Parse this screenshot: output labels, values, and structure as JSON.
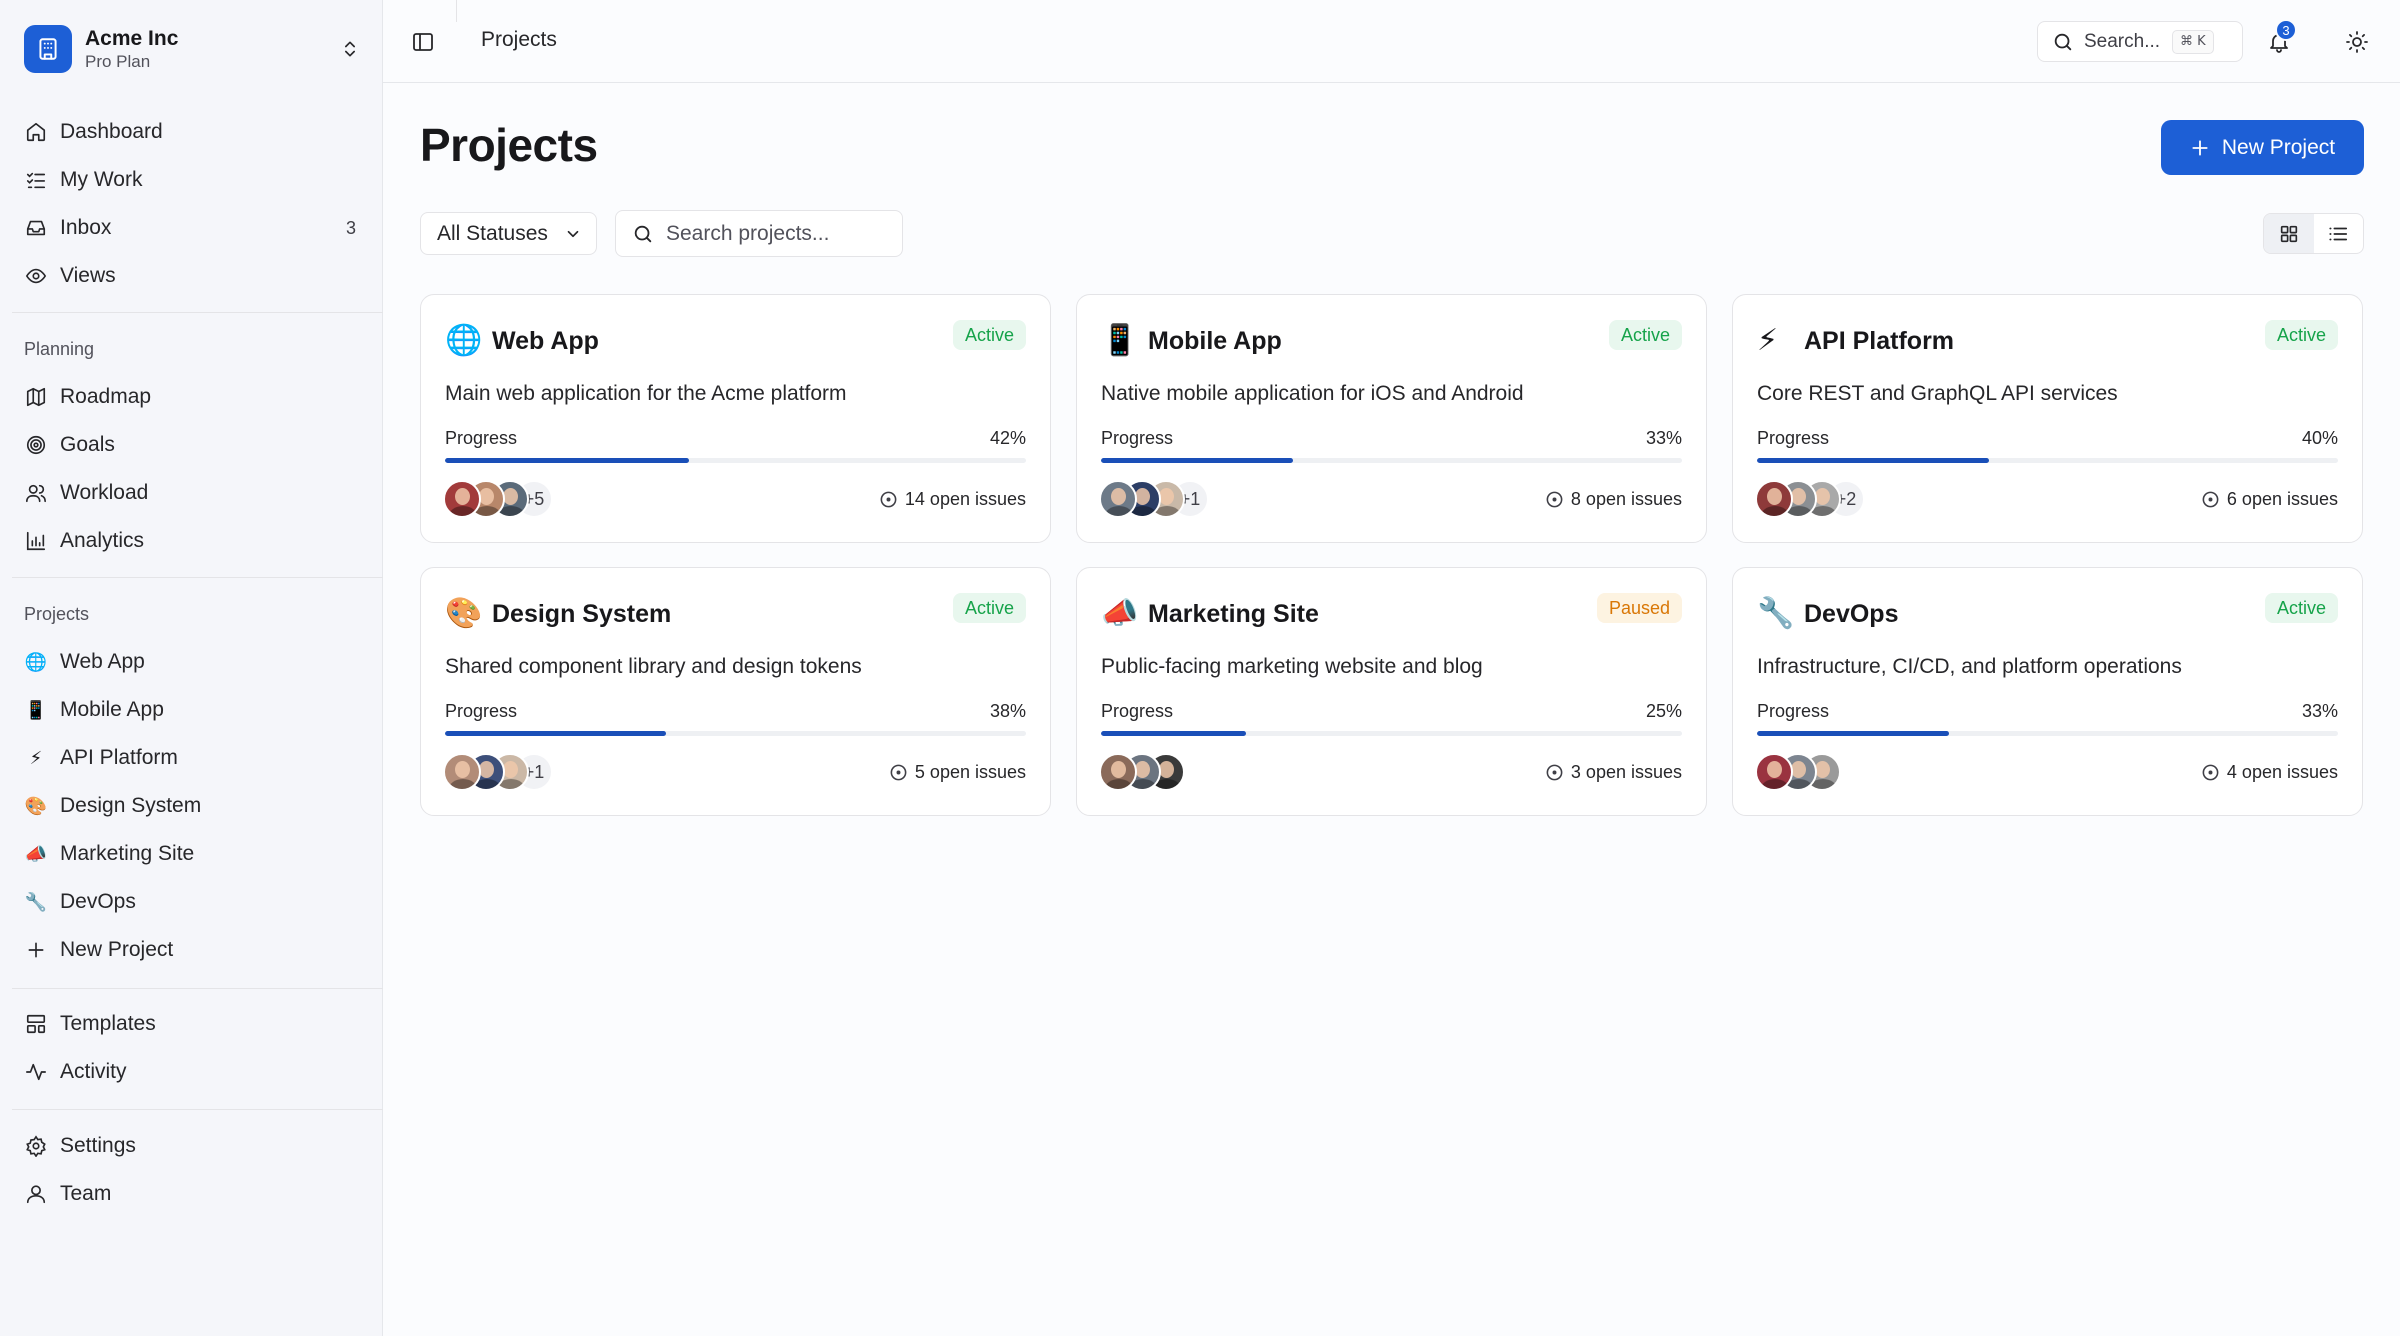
{
  "org": {
    "name": "Acme Inc",
    "plan": "Pro Plan"
  },
  "nav": {
    "dashboard": "Dashboard",
    "my_work": "My Work",
    "inbox": "Inbox",
    "inbox_count": "3",
    "views": "Views"
  },
  "planning": {
    "label": "Planning",
    "roadmap": "Roadmap",
    "goals": "Goals",
    "workload": "Workload",
    "analytics": "Analytics"
  },
  "projects_section": {
    "label": "Projects",
    "items": [
      {
        "icon": "🌐",
        "label": "Web App"
      },
      {
        "icon": "📱",
        "label": "Mobile App"
      },
      {
        "icon": "⚡",
        "label": "API Platform"
      },
      {
        "icon": "🎨",
        "label": "Design System"
      },
      {
        "icon": "📣",
        "label": "Marketing Site"
      },
      {
        "icon": "🔧",
        "label": "DevOps"
      }
    ],
    "new_project": "New Project"
  },
  "misc": {
    "templates": "Templates",
    "activity": "Activity",
    "settings": "Settings",
    "team": "Team"
  },
  "topbar": {
    "breadcrumb": "Projects",
    "search_placeholder": "Search...",
    "shortcut": "⌘ K",
    "notification_count": "3"
  },
  "page": {
    "title": "Projects",
    "new_button": "New Project",
    "status_filter": "All Statuses",
    "search_placeholder": "Search projects..."
  },
  "cards": [
    {
      "icon": "🌐",
      "name": "Web App",
      "status": "Active",
      "description": "Main web application for the Acme platform",
      "progress_label": "Progress",
      "progress": 42,
      "progress_text": "42%",
      "avatar_colors": [
        "#a23b3b",
        "#b8876a",
        "#5b6b7a"
      ],
      "more": "+5",
      "issues": "14 open issues"
    },
    {
      "icon": "📱",
      "name": "Mobile App",
      "status": "Active",
      "description": "Native mobile application for iOS and Android",
      "progress_label": "Progress",
      "progress": 33,
      "progress_text": "33%",
      "avatar_colors": [
        "#6d7a88",
        "#2c3e66",
        "#c9b9a8"
      ],
      "more": "+1",
      "issues": "8 open issues"
    },
    {
      "icon": "⚡",
      "name": "API Platform",
      "status": "Active",
      "description": "Core REST and GraphQL API services",
      "progress_label": "Progress",
      "progress": 40,
      "progress_text": "40%",
      "avatar_colors": [
        "#8e3a3a",
        "#8b8f93",
        "#a9a9a9"
      ],
      "more": "+2",
      "issues": "6 open issues"
    },
    {
      "icon": "🎨",
      "name": "Design System",
      "status": "Active",
      "description": "Shared component library and design tokens",
      "progress_label": "Progress",
      "progress": 38,
      "progress_text": "38%",
      "avatar_colors": [
        "#b28c78",
        "#3d4f7a",
        "#cbb8a6"
      ],
      "more": "+1",
      "issues": "5 open issues"
    },
    {
      "icon": "📣",
      "name": "Marketing Site",
      "status": "Paused",
      "description": "Public-facing marketing website and blog",
      "progress_label": "Progress",
      "progress": 25,
      "progress_text": "25%",
      "avatar_colors": [
        "#8a6a5a",
        "#6b7480",
        "#3a3a3a"
      ],
      "more": "",
      "issues": "3 open issues"
    },
    {
      "icon": "🔧",
      "name": "DevOps",
      "status": "Active",
      "description": "Infrastructure, CI/CD, and platform operations",
      "progress_label": "Progress",
      "progress": 33,
      "progress_text": "33%",
      "avatar_colors": [
        "#9a3340",
        "#7d8590",
        "#9a9a9a"
      ],
      "more": "",
      "issues": "4 open issues"
    }
  ],
  "colors": {
    "accent": "#1d5fd6",
    "progress": "#1a4fb8",
    "active": "#16a34a",
    "paused": "#d97706"
  }
}
